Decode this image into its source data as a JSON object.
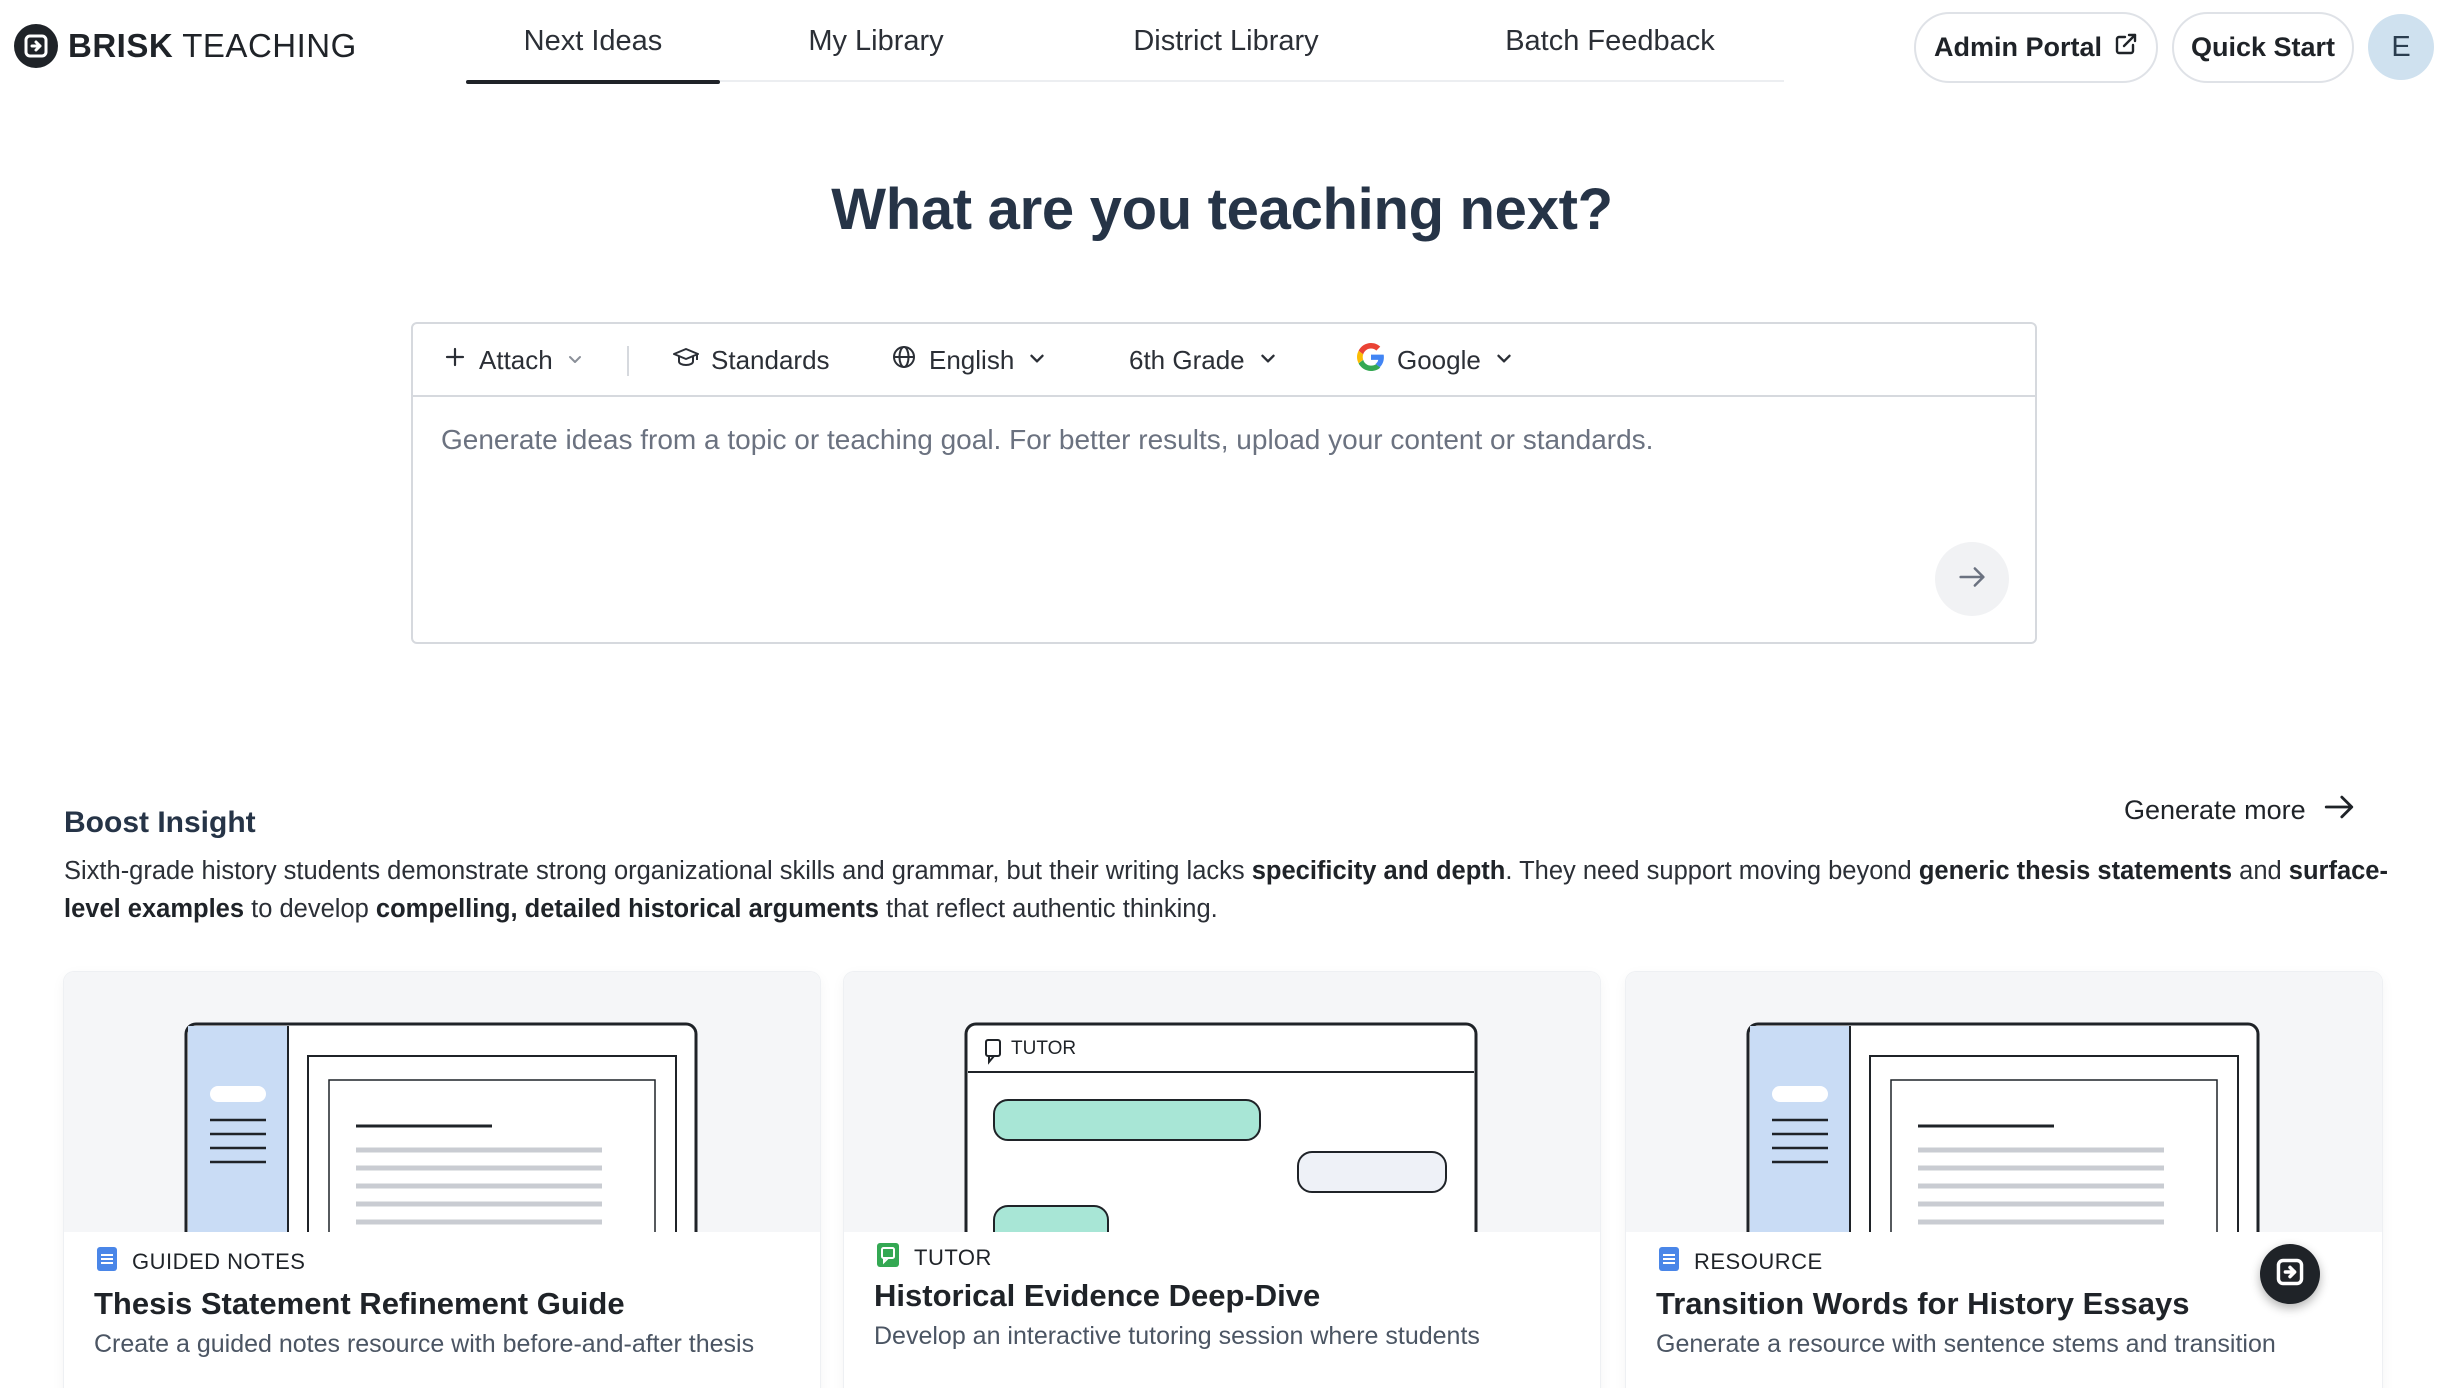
{
  "brand": {
    "bold": "BRISK",
    "light": "TEACHING"
  },
  "nav": {
    "tabs": [
      {
        "label": "Next Ideas",
        "active": true
      },
      {
        "label": "My Library",
        "active": false
      },
      {
        "label": "District Library",
        "active": false
      },
      {
        "label": "Batch Feedback",
        "active": false
      }
    ]
  },
  "header_actions": {
    "admin_portal": "Admin Portal",
    "quick_start": "Quick Start",
    "avatar_initial": "E"
  },
  "hero": {
    "title": "What are you teaching next?",
    "toolbar": {
      "attach": "Attach",
      "standards": "Standards",
      "language": "English",
      "grade": "6th Grade",
      "provider": "Google"
    },
    "placeholder": "Generate ideas from a topic or teaching goal. For better results, upload your content or standards."
  },
  "insight": {
    "title": "Boost Insight",
    "generate_more": "Generate more",
    "segments": [
      {
        "text": "Sixth-grade history students demonstrate strong organizational skills and grammar, but their writing lacks ",
        "bold": false
      },
      {
        "text": "specificity and depth",
        "bold": true
      },
      {
        "text": ". They need support moving beyond ",
        "bold": false
      },
      {
        "text": "generic thesis statements",
        "bold": true
      },
      {
        "text": " and ",
        "bold": false
      },
      {
        "text": "surface-level examples",
        "bold": true
      },
      {
        "text": " to develop ",
        "bold": false
      },
      {
        "text": "compelling, detailed historical arguments",
        "bold": true
      },
      {
        "text": " that reflect authentic thinking.",
        "bold": false
      }
    ]
  },
  "cards": [
    {
      "type": "GUIDED NOTES",
      "title": "Thesis Statement Refinement Guide",
      "description": "Create a guided notes resource with before-and-after thesis",
      "illustration": "document"
    },
    {
      "type": "TUTOR",
      "title": "Historical Evidence Deep-Dive",
      "description": "Develop an interactive tutoring session where students",
      "illustration": "chat",
      "illustration_label": "TUTOR"
    },
    {
      "type": "RESOURCE",
      "title": "Transition Words for History Essays",
      "description": "Generate a resource with sentence stems and transition",
      "illustration": "document"
    }
  ],
  "colors": {
    "accent_dark": "#1f2328",
    "doc_icon": "#4a86e8",
    "tutor_icon": "#34a853",
    "chat_bubble_mint": "#a8e6d6",
    "chat_bubble_light": "#eef1f7",
    "illus_sidebar": "#c9dcf5"
  },
  "icons": {
    "attach": "plus-icon",
    "standards": "graduation-cap-icon",
    "language": "globe-icon",
    "provider": "google-g-icon",
    "send": "arrow-right-icon",
    "admin_portal": "external-link-icon"
  }
}
